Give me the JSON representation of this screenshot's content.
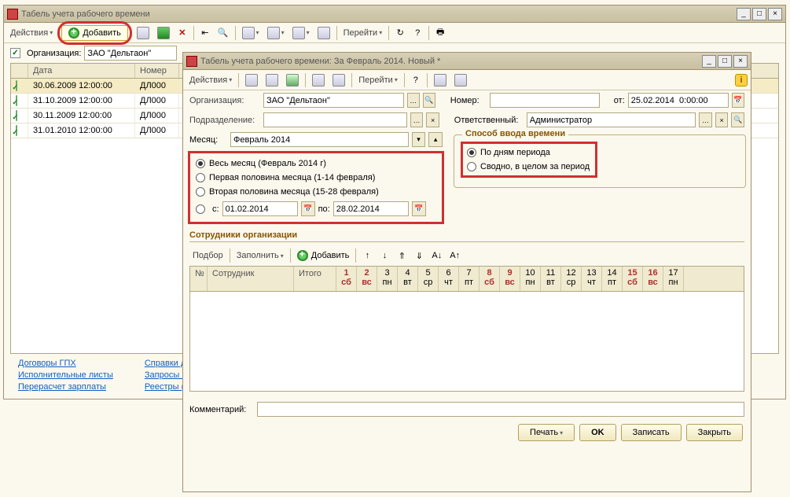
{
  "outer_window": {
    "title": "Табель учета рабочего времени",
    "toolbar": {
      "actions_label": "Действия",
      "add_label": "Добавить",
      "goto_label": "Перейти"
    },
    "org_checkbox_label": "Организация:",
    "org_value": "ЗАО \"Дельтаон\"",
    "grid": {
      "col_date": "Дата",
      "col_number": "Номер",
      "rows": [
        {
          "date": "30.06.2009 12:00:00",
          "number": "ДЛ000"
        },
        {
          "date": "31.10.2009 12:00:00",
          "number": "ДЛ000"
        },
        {
          "date": "30.11.2009 12:00:00",
          "number": "ДЛ000"
        },
        {
          "date": "31.01.2010 12:00:00",
          "number": "ДЛ000"
        }
      ]
    },
    "footer_links": {
      "col1": [
        "Договоры ГПХ",
        "Исполнительные листы",
        "Перерасчет зарплаты"
      ],
      "col2": [
        "Справки д",
        "Запросы в",
        "Реестры (п"
      ]
    }
  },
  "inner_window": {
    "title": "Табель учета рабочего времени: За Февраль 2014. Новый *",
    "toolbar": {
      "actions_label": "Действия",
      "goto_label": "Перейти"
    },
    "fields": {
      "org_label": "Организация:",
      "org_value": "ЗАО \"Дельтаон\"",
      "dept_label": "Подразделение:",
      "dept_value": "",
      "number_label": "Номер:",
      "number_value": "",
      "from_label": "от:",
      "from_value": "25.02.2014  0:00:00",
      "responsible_label": "Ответственный:",
      "responsible_value": "Администратор",
      "month_label": "Месяц:",
      "month_value": "Февраль 2014",
      "comment_label": "Комментарий:",
      "comment_value": ""
    },
    "period_options": {
      "whole_month": "Весь месяц (Февраль 2014 г)",
      "first_half": "Первая половина месяца (1-14 февраля)",
      "second_half": "Вторая половина месяца (15-28 февраля)",
      "from_label": "с:",
      "from_value": "01.02.2014",
      "to_label": "по:",
      "to_value": "28.02.2014"
    },
    "input_method": {
      "title": "Способ ввода времени",
      "by_days": "По дням периода",
      "summary": "Сводно, в целом за период"
    },
    "employees": {
      "title": "Сотрудники организации",
      "pick_label": "Подбор",
      "fill_label": "Заполнить",
      "add_label": "Добавить",
      "col_n": "№",
      "col_employee": "Сотрудник",
      "col_total": "Итого",
      "days": [
        {
          "n": "1",
          "d": "сб",
          "w": true
        },
        {
          "n": "2",
          "d": "вс",
          "w": true
        },
        {
          "n": "3",
          "d": "пн",
          "w": false
        },
        {
          "n": "4",
          "d": "вт",
          "w": false
        },
        {
          "n": "5",
          "d": "ср",
          "w": false
        },
        {
          "n": "6",
          "d": "чт",
          "w": false
        },
        {
          "n": "7",
          "d": "пт",
          "w": false
        },
        {
          "n": "8",
          "d": "сб",
          "w": true
        },
        {
          "n": "9",
          "d": "вс",
          "w": true
        },
        {
          "n": "10",
          "d": "пн",
          "w": false
        },
        {
          "n": "11",
          "d": "вт",
          "w": false
        },
        {
          "n": "12",
          "d": "ср",
          "w": false
        },
        {
          "n": "13",
          "d": "чт",
          "w": false
        },
        {
          "n": "14",
          "d": "пт",
          "w": false
        },
        {
          "n": "15",
          "d": "сб",
          "w": true
        },
        {
          "n": "16",
          "d": "вс",
          "w": true
        },
        {
          "n": "17",
          "d": "пн",
          "w": false
        }
      ]
    },
    "buttons": {
      "print": "Печать",
      "ok": "OK",
      "save": "Записать",
      "close": "Закрыть"
    }
  }
}
